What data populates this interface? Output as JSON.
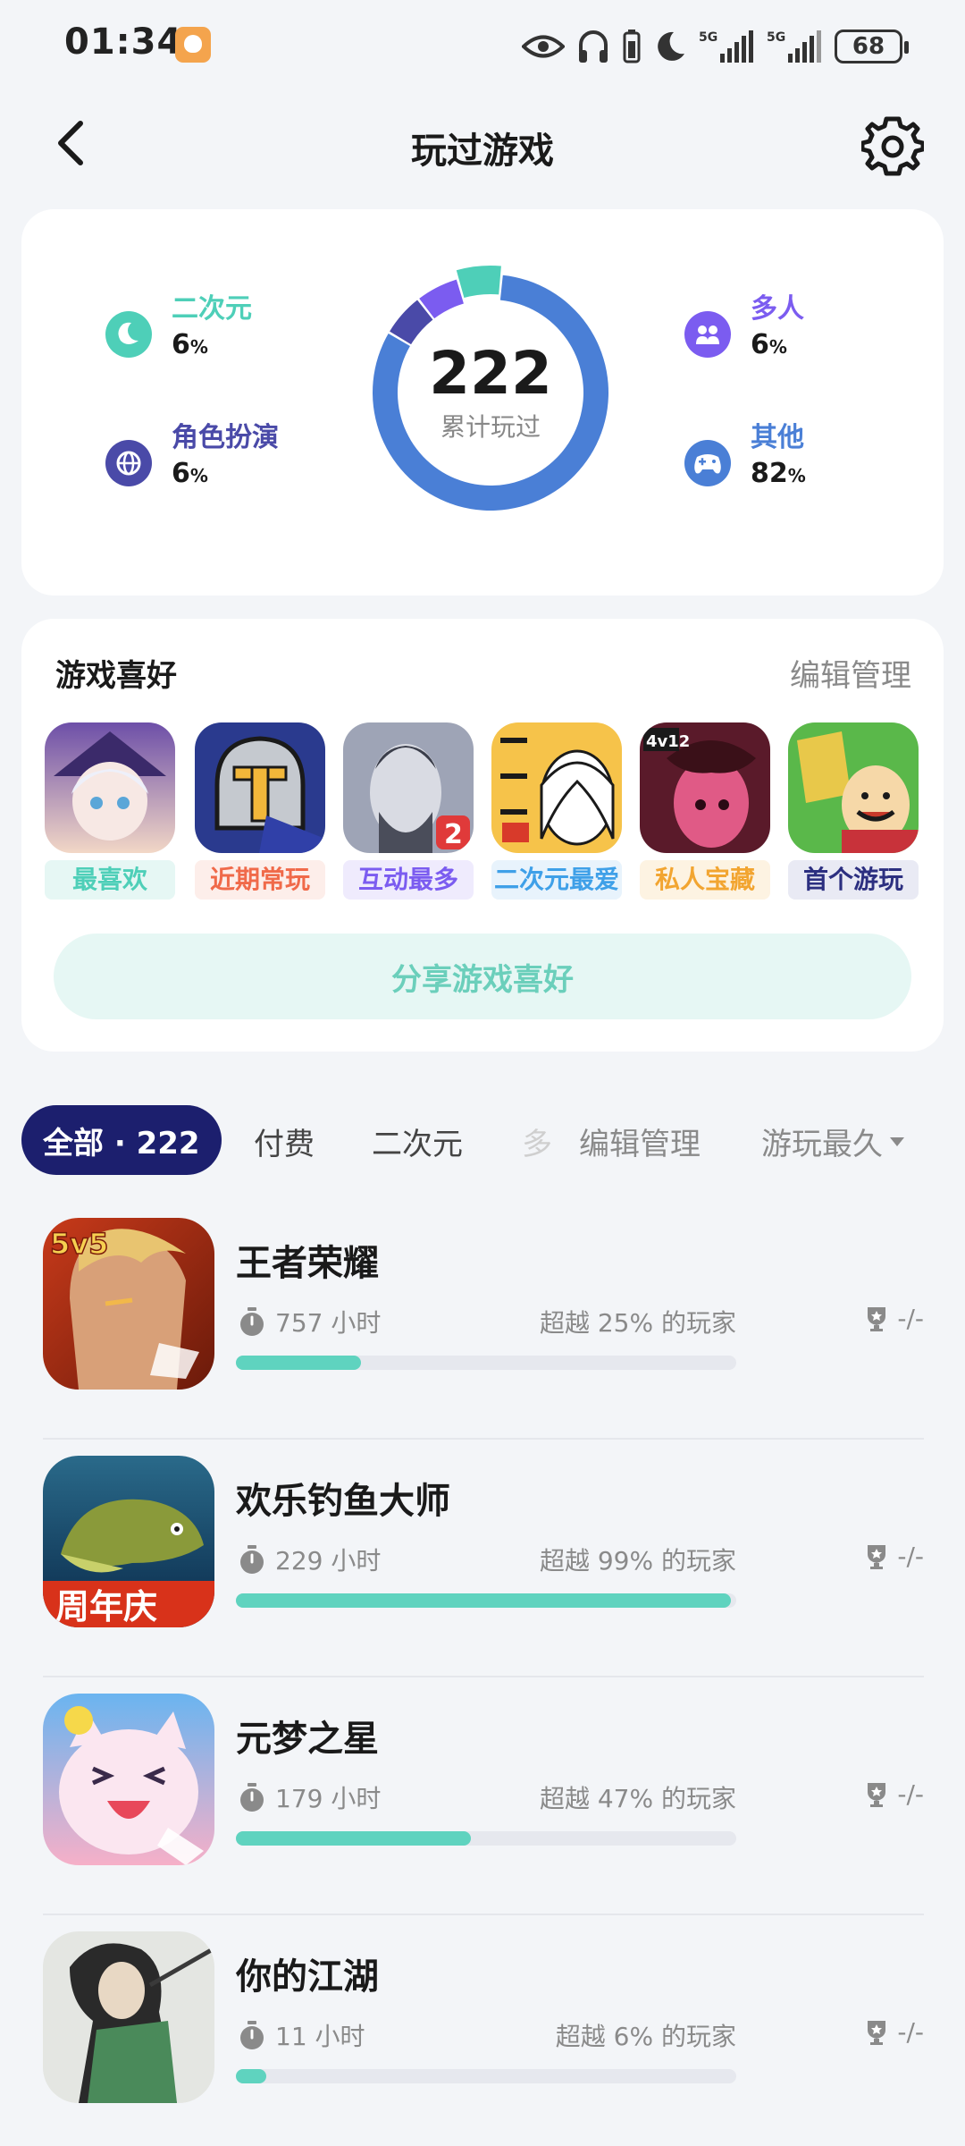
{
  "status": {
    "time": "01:34",
    "battery": "68",
    "net1": "5G",
    "net2": "5G"
  },
  "header": {
    "title": "玩过游戏"
  },
  "summary": {
    "total": "222",
    "total_label": "累计玩过",
    "categories": [
      {
        "name": "二次元",
        "pct": "6",
        "unit": "%",
        "color": "#4ecfb8",
        "icon": "anime-icon"
      },
      {
        "name": "角色扮演",
        "pct": "6",
        "unit": "%",
        "color": "#4a4aa8",
        "icon": "globe-icon"
      },
      {
        "name": "多人",
        "pct": "6",
        "unit": "%",
        "color": "#7b5cf0",
        "icon": "multiplayer-icon"
      },
      {
        "name": "其他",
        "pct": "82",
        "unit": "%",
        "color": "#4a7fd6",
        "icon": "gamepad-icon"
      }
    ]
  },
  "preferences": {
    "title": "游戏喜好",
    "edit": "编辑管理",
    "items": [
      {
        "tag": "最喜欢",
        "color": "#4ecfb8",
        "bg": "#e6f7f4"
      },
      {
        "tag": "近期常玩",
        "color": "#f06a4a",
        "bg": "#fdeeea"
      },
      {
        "tag": "互动最多",
        "color": "#7b5cf0",
        "bg": "#efebfd"
      },
      {
        "tag": "二次元最爱",
        "color": "#3fa0e8",
        "bg": "#e8f3fc"
      },
      {
        "tag": "私人宝藏",
        "color": "#f2a531",
        "bg": "#fdf3e2"
      },
      {
        "tag": "首个游玩",
        "color": "#2c2f80",
        "bg": "#e9eaf4"
      }
    ],
    "share": "分享游戏喜好"
  },
  "filters": {
    "all": "全部 · 222",
    "tab1": "付费",
    "tab2": "二次元",
    "tab3": "多",
    "edit": "编辑管理",
    "sort": "游玩最久"
  },
  "games": [
    {
      "name": "王者荣耀",
      "hours": "757 小时",
      "beat": "超越 25% 的玩家",
      "trophy": "-/-",
      "progress": 0.25
    },
    {
      "name": "欢乐钓鱼大师",
      "hours": "229 小时",
      "beat": "超越 99% 的玩家",
      "trophy": "-/-",
      "progress": 0.99
    },
    {
      "name": "元梦之星",
      "hours": "179 小时",
      "beat": "超越 47% 的玩家",
      "trophy": "-/-",
      "progress": 0.47
    },
    {
      "name": "你的江湖",
      "hours": "11 小时",
      "beat": "超越 6% 的玩家",
      "trophy": "-/-",
      "progress": 0.06
    }
  ],
  "chart_data": {
    "type": "pie",
    "categories": [
      "二次元",
      "角色扮演",
      "多人",
      "其他"
    ],
    "values": [
      6,
      6,
      6,
      82
    ]
  }
}
